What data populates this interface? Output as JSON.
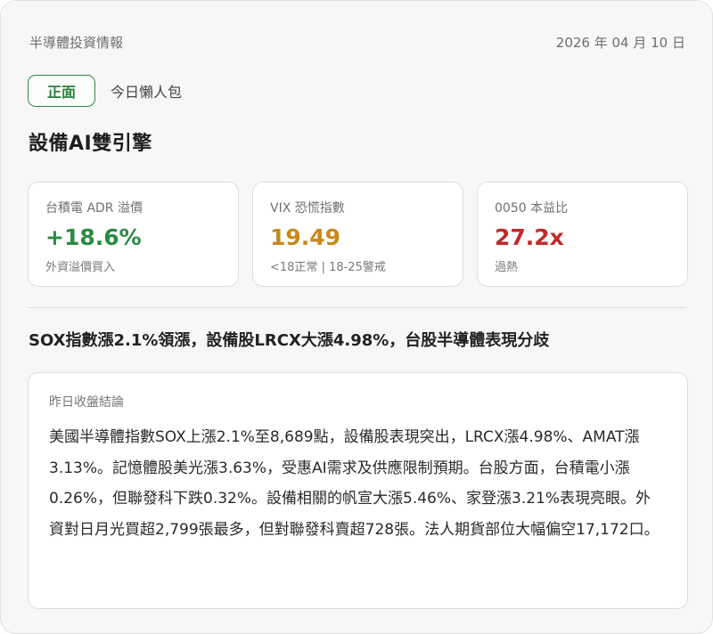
{
  "brand": "半導體投資情報",
  "date": "2026 年 04 月 10 日",
  "tag": "正面",
  "subtag": "今日懶人包",
  "headline": "設備AI雙引擎",
  "metrics": [
    {
      "label": "台積電 ADR 溢價",
      "value": "+18.6%",
      "note": "外資溢價買入",
      "color": "#2a8a44"
    },
    {
      "label": "VIX 恐慌指數",
      "value": "19.49",
      "note": "<18正常 | 18-25警戒",
      "color": "#c8891a"
    },
    {
      "label": "0050 本益比",
      "value": "27.2x",
      "note": "過熱",
      "color": "#c22a2a"
    }
  ],
  "summary": "SOX指數漲2.1%領漲，設備股LRCX大漲4.98%，台股半導體表現分歧",
  "detail": {
    "label": "昨日收盤結論",
    "body": "美國半導體指數SOX上漲2.1%至8,689點，設備股表現突出，LRCX漲4.98%、AMAT漲3.13%。記憶體股美光漲3.63%，受惠AI需求及供應限制預期。台股方面，台積電小漲0.26%，但聯發科下跌0.32%。設備相關的帆宣大漲5.46%、家登漲3.21%表現亮眼。外資對日月光買超2,799張最多，但對聯發科賣超728張。法人期貨部位大幅偏空17,172口。"
  }
}
